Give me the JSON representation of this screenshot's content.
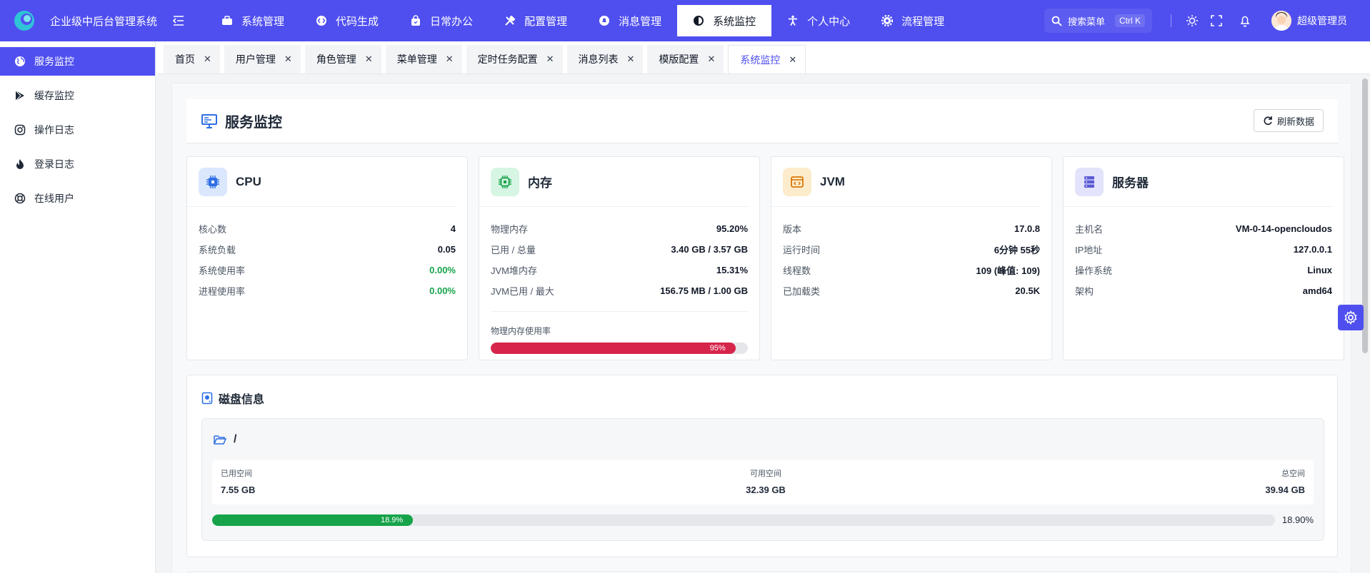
{
  "header": {
    "app_title": "企业级中后台管理系统",
    "nav": [
      {
        "label": "系统管理",
        "icon": "briefcase-icon"
      },
      {
        "label": "代码生成",
        "icon": "code-icon"
      },
      {
        "label": "日常办公",
        "icon": "bag-icon"
      },
      {
        "label": "配置管理",
        "icon": "tools-icon"
      },
      {
        "label": "消息管理",
        "icon": "bell-circle-icon"
      },
      {
        "label": "系统监控",
        "icon": "contrast-icon",
        "active": true
      },
      {
        "label": "个人中心",
        "icon": "person-icon"
      },
      {
        "label": "流程管理",
        "icon": "gear-icon"
      }
    ],
    "search_label": "搜索菜单",
    "search_shortcut": "Ctrl K",
    "user_name": "超级管理员"
  },
  "sidebar": {
    "items": [
      {
        "label": "服务监控",
        "icon": "globe-icon",
        "active": true
      },
      {
        "label": "缓存监控",
        "icon": "play-store-icon"
      },
      {
        "label": "操作日志",
        "icon": "instagram-icon"
      },
      {
        "label": "登录日志",
        "icon": "flame-icon"
      },
      {
        "label": "在线用户",
        "icon": "lifebuoy-icon"
      }
    ]
  },
  "tabs": [
    {
      "label": "首页"
    },
    {
      "label": "用户管理"
    },
    {
      "label": "角色管理"
    },
    {
      "label": "菜单管理"
    },
    {
      "label": "定时任务配置"
    },
    {
      "label": "消息列表"
    },
    {
      "label": "模版配置"
    },
    {
      "label": "系统监控",
      "active": true
    }
  ],
  "page": {
    "title": "服务监控",
    "refresh_label": "刷新数据"
  },
  "cards": {
    "cpu": {
      "title": "CPU",
      "rows": [
        {
          "k": "核心数",
          "v": "4"
        },
        {
          "k": "系统负载",
          "v": "0.05"
        },
        {
          "k": "系统使用率",
          "v": "0.00%"
        },
        {
          "k": "进程使用率",
          "v": "0.00%"
        }
      ]
    },
    "memory": {
      "title": "内存",
      "rows": [
        {
          "k": "物理内存",
          "v": "95.20%"
        },
        {
          "k": "已用 / 总量",
          "v": "3.40 GB / 3.57 GB"
        },
        {
          "k": "JVM堆内存",
          "v": "15.31%"
        },
        {
          "k": "JVM已用 / 最大",
          "v": "156.75 MB / 1.00 GB"
        }
      ],
      "usage_label": "物理内存使用率",
      "usage_text": "95%",
      "usage_fraction": 0.952
    },
    "jvm": {
      "title": "JVM",
      "rows": [
        {
          "k": "版本",
          "v": "17.0.8"
        },
        {
          "k": "运行时间",
          "v": "6分钟 55秒"
        },
        {
          "k": "线程数",
          "v": "109 (峰值: 109)"
        },
        {
          "k": "已加载类",
          "v": "20.5K"
        }
      ]
    },
    "server": {
      "title": "服务器",
      "rows": [
        {
          "k": "主机名",
          "v": "VM-0-14-opencloudos"
        },
        {
          "k": "IP地址",
          "v": "127.0.0.1"
        },
        {
          "k": "操作系统",
          "v": "Linux"
        },
        {
          "k": "架构",
          "v": "amd64"
        }
      ]
    }
  },
  "disk": {
    "title": "磁盘信息",
    "mount": "/",
    "used_label": "已用空间",
    "used_value": "7.55 GB",
    "free_label": "可用空间",
    "free_value": "32.39 GB",
    "total_label": "总空间",
    "total_value": "39.94 GB",
    "bar_text": "18.9%",
    "percent_text": "18.90%",
    "usage_fraction": 0.189
  },
  "colors": {
    "brand": "#4f4ff0",
    "danger": "#d6254b",
    "success": "#16a34a"
  }
}
